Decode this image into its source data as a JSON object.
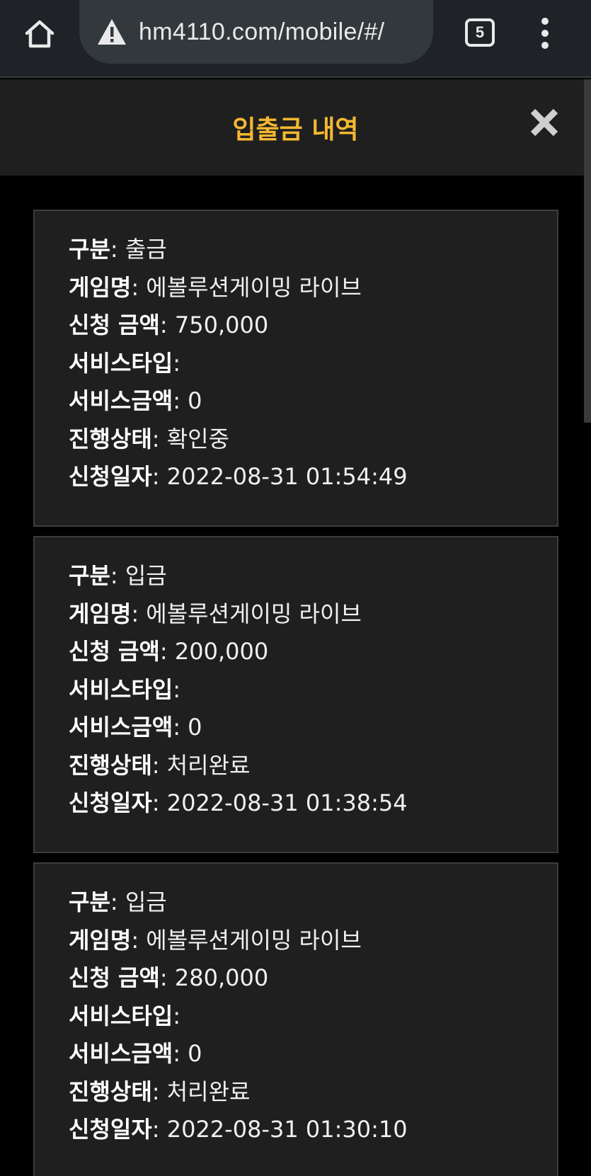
{
  "browser": {
    "url": "hm4110.com/mobile/#/",
    "tab_count": "5",
    "home_icon": "home-icon",
    "warning_icon": "warning-icon",
    "menu_icon": "more-vert-icon"
  },
  "modal": {
    "title": "입출금 내역",
    "close_icon": "close-icon",
    "title_color": "#f5b831"
  },
  "labels": {
    "type": "구분",
    "game": "게임명",
    "amount": "신청 금액",
    "service_type": "서비스타입",
    "service_amount": "서비스금액",
    "status": "진행상태",
    "date": "신청일자"
  },
  "records": [
    {
      "type": "출금",
      "game": "에볼루션게이밍 라이브",
      "amount": "750,000",
      "service_type": "",
      "service_amount": "0",
      "status": "확인중",
      "date": "2022-08-31 01:54:49"
    },
    {
      "type": "입금",
      "game": "에볼루션게이밍 라이브",
      "amount": "200,000",
      "service_type": "",
      "service_amount": "0",
      "status": "처리완료",
      "date": "2022-08-31 01:38:54"
    },
    {
      "type": "입금",
      "game": "에볼루션게이밍 라이브",
      "amount": "280,000",
      "service_type": "",
      "service_amount": "0",
      "status": "처리완료",
      "date": "2022-08-31 01:30:10"
    }
  ]
}
